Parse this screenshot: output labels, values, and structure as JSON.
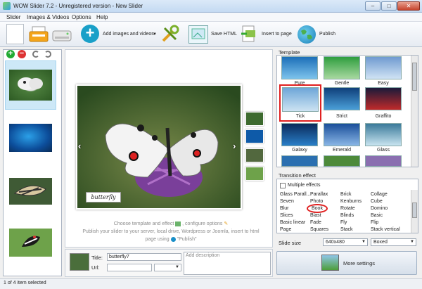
{
  "window": {
    "title": "WOW Slider 7.2 - Unregistered version - New Slider",
    "minimize": "–",
    "maximize": "□",
    "close": "✕"
  },
  "menu": [
    "Slider",
    "Images & Videos",
    "Options",
    "Help"
  ],
  "toolbar": {
    "add_label": "Add images and videos",
    "save_html": "Save HTML",
    "insert": "Insert to page",
    "publish": "Publish"
  },
  "slide": {
    "caption": "butterfly"
  },
  "help": {
    "line1": "Choose template and effect",
    "line1b": ", configure options",
    "line2": "Publish your slider to your server, local drive, Wordpress or Joomla, insert to html",
    "line3": "page using",
    "line3b": "\"Publish\""
  },
  "fields": {
    "title_label": "Title:",
    "title_value": "butterfly7",
    "url_label": "Url:",
    "desc_placeholder": "Add description"
  },
  "template": {
    "header": "Template",
    "names": [
      "Pure",
      "Gentle",
      "Easy",
      "Tick",
      "Strict",
      "Graffito",
      "Galaxy",
      "Emerald",
      "Glass"
    ]
  },
  "transition": {
    "header": "Transition effect",
    "multiple": "Multiple effects",
    "columns": [
      [
        "Glass Parall...",
        "Seven",
        "Blur",
        "Slices",
        "Basic linear",
        "Page"
      ],
      [
        "Parallax",
        "Photo",
        "Book",
        "Blast",
        "Fade",
        "Squares"
      ],
      [
        "Brick",
        "Kenburns",
        "Rotate",
        "Blinds",
        "Fly",
        "Stack"
      ],
      [
        "Collage",
        "Cube",
        "Domino",
        "Basic",
        "Flip",
        "Stack vertical"
      ]
    ]
  },
  "slide_size": {
    "label": "Slide size",
    "size": "640x480",
    "mode": "Boxed"
  },
  "more_settings": "More settings",
  "status": "1 of 4 item selected",
  "colors": {
    "accent": "#1aa0c8",
    "highlight": "#e02020",
    "selection": "#cde8f7"
  }
}
